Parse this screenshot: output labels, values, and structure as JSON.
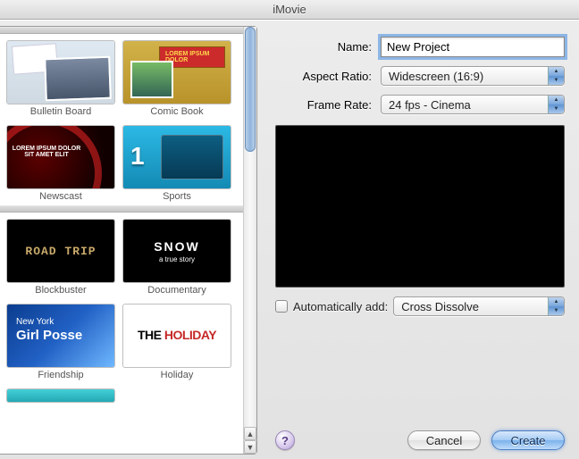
{
  "window_title": "iMovie",
  "templates": {
    "groups": [
      {
        "items": [
          {
            "key": "bulletin",
            "label": "Bulletin Board"
          },
          {
            "key": "comic",
            "label": "Comic Book"
          },
          {
            "key": "newscast",
            "label": "Newscast"
          },
          {
            "key": "sports",
            "label": "Sports"
          }
        ]
      },
      {
        "items": [
          {
            "key": "blockbuster",
            "label": "Blockbuster"
          },
          {
            "key": "documentary",
            "label": "Documentary"
          },
          {
            "key": "friendship",
            "label": "Friendship"
          },
          {
            "key": "holiday",
            "label": "Holiday"
          }
        ]
      }
    ]
  },
  "thumb_text": {
    "documentary_title": "SNOW",
    "documentary_sub": "a true story",
    "friendship_line1": "New York",
    "friendship_line2": "Girl Posse",
    "holiday_prefix": "THE ",
    "holiday_word": "HOLIDAY"
  },
  "form": {
    "name_label": "Name:",
    "name_value": "New Project",
    "aspect_label": "Aspect Ratio:",
    "aspect_value": "Widescreen (16:9)",
    "frame_label": "Frame Rate:",
    "frame_value": "24 fps - Cinema"
  },
  "auto": {
    "checkbox_checked": false,
    "label": "Automatically add:",
    "transition_value": "Cross Dissolve"
  },
  "buttons": {
    "help_glyph": "?",
    "cancel": "Cancel",
    "create": "Create"
  }
}
